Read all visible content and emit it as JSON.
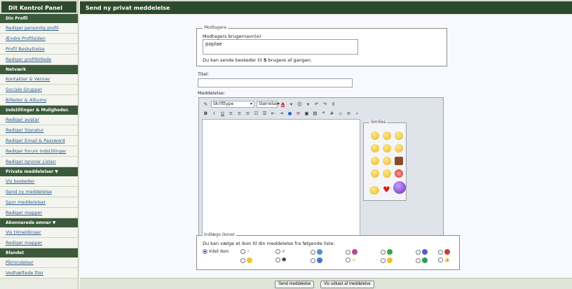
{
  "sidebar": {
    "title": "Dit Kontrol Panel",
    "sections": [
      {
        "label": "Din Profil",
        "items": [
          "Rediger personlig profil",
          "Ændre Profilsiden",
          "Profil Beskyttelse",
          "Rediger profilbillede"
        ]
      },
      {
        "label": "Netværk",
        "items": [
          "Kontakter & Venner",
          "Sociale Grupper",
          "Billeder & Albums"
        ]
      },
      {
        "label": "Indstillinger & Muligheder.",
        "items": [
          "Rediger avatar",
          "Rediger Signatur",
          "Rediger Email & Password",
          "Rediger forum indstillinger",
          "Rediger Ignorer Listen"
        ]
      },
      {
        "label": "Private meddelelser ▼",
        "items": [
          "Vis beskeder",
          "Send ny meddelelse",
          "Spor meddelelser",
          "Rediger mapper"
        ]
      },
      {
        "label": "Abonnerede emner ▼",
        "items": [
          "Vis tilmeldinger",
          "Rediger mapper"
        ]
      },
      {
        "label": "Blandet",
        "items": [
          "Påmindelser",
          "Vedhæftede filer"
        ]
      }
    ]
  },
  "header": {
    "title": "Send ny privat meddelelse"
  },
  "recipients": {
    "legend": "Modtagere",
    "label": "Modtagers brugernavn(e)",
    "value": "poplae",
    "note_prefix": "Du kan sende beskeder til",
    "note_count": "5",
    "note_suffix": "brugere af gangen."
  },
  "title_field": {
    "label": "Titel:",
    "value": ""
  },
  "message": {
    "label": "Meddelelse:",
    "font_select": "Skrifttype",
    "size_select": "Størrelse",
    "smilies_legend": "Smilies"
  },
  "icons": {
    "legend": "Indlægs ikoner",
    "instruction": "Du kan vælge et ikon til din meddelelse fra følgende liste:",
    "no_icon_label": "Intet ikon",
    "selected": "Intet ikon"
  },
  "buttons": {
    "send": "Send meddelelse",
    "preview": "Vis udkast af meddelelse"
  },
  "colors": {
    "header": "#2d4a2d",
    "link": "#2f5d92",
    "sidebar_bg": "#e9ece2"
  }
}
